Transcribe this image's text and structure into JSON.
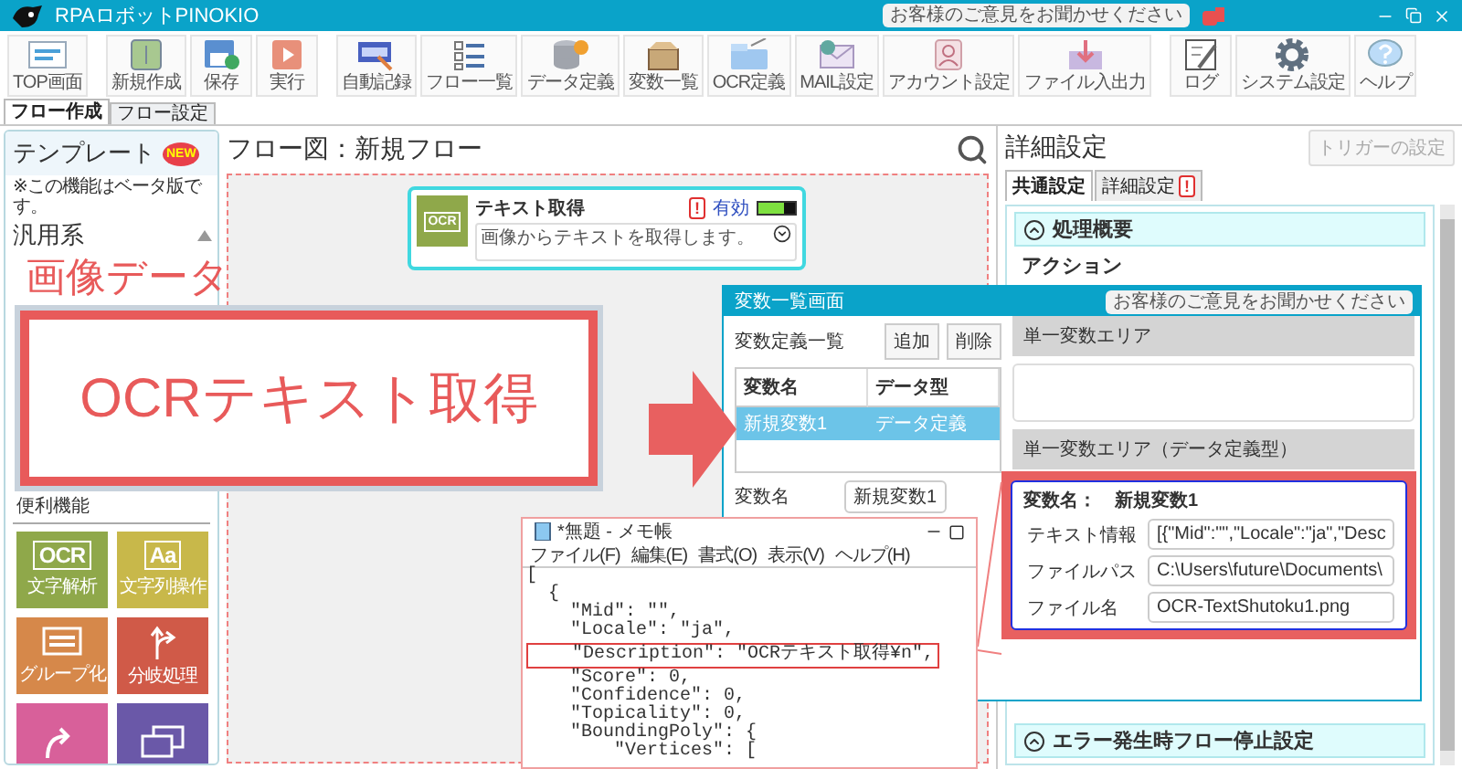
{
  "title_bar": {
    "title": "RPAロボットPINOKIO",
    "feedback": "お客様のご意見をお聞かせください"
  },
  "toolbar_groups": [
    [
      {
        "label": "TOP画面",
        "kind": "top"
      }
    ],
    [
      {
        "label": "新規作成",
        "kind": "new"
      },
      {
        "label": "保存",
        "kind": "save"
      },
      {
        "label": "実行",
        "kind": "run"
      }
    ],
    [
      {
        "label": "自動記録",
        "kind": "record"
      },
      {
        "label": "フロー一覧",
        "kind": "list"
      },
      {
        "label": "データ定義",
        "kind": "data"
      },
      {
        "label": "変数一覧",
        "kind": "vars"
      },
      {
        "label": "OCR定義",
        "kind": "ocr"
      },
      {
        "label": "MAIL設定",
        "kind": "mail"
      },
      {
        "label": "アカウント設定",
        "kind": "account"
      },
      {
        "label": "ファイル入出力",
        "kind": "file"
      }
    ],
    [
      {
        "label": "ログ",
        "kind": "log"
      },
      {
        "label": "システム設定",
        "kind": "settings"
      },
      {
        "label": "ヘルプ",
        "kind": "help"
      }
    ]
  ],
  "main_tabs": [
    {
      "label": "フロー作成",
      "selected": true
    },
    {
      "label": "フロー設定",
      "selected": false
    }
  ],
  "sidebar": {
    "title": "テンプレート",
    "badge": "NEW",
    "note": "※この機能はベータ版です。",
    "category": "汎用系",
    "section": "便利機能",
    "tiles": [
      {
        "kind": "ocr",
        "icon_text": "OCR",
        "label": "文字解析",
        "color": "#8fa84a"
      },
      {
        "kind": "text",
        "icon_text": "Aa",
        "label": "文字列操作",
        "color": "#c8b84a"
      },
      {
        "kind": "group",
        "label": "グループ化",
        "color": "#d6884a"
      },
      {
        "kind": "branch",
        "label": "分岐処理",
        "color": "#d05a48"
      },
      {
        "kind": "loop",
        "color": "#d8609a"
      },
      {
        "kind": "window",
        "color": "#6a58a8"
      }
    ]
  },
  "canvas": {
    "title": "フロー図：新規フロー",
    "node": {
      "title": "テキスト取得",
      "icon_text": "OCR",
      "warning": "!",
      "status": "有効",
      "enabled": true,
      "description": "画像からテキストを取得します。"
    }
  },
  "details": {
    "title": "詳細設定",
    "trigger_button": {
      "label": "トリガーの設定",
      "disabled": true
    },
    "tabs": [
      {
        "label": "共通設定",
        "selected": true
      },
      {
        "label": "詳細設定",
        "selected": false,
        "warning": "!"
      }
    ],
    "top_section": {
      "title": "処理概要",
      "expanded": true
    },
    "action_label": "アクション",
    "bottom_section": {
      "title": "エラー発生時フロー停止設定",
      "expanded": true
    }
  },
  "annotation": {
    "caption": "画像データ",
    "image_text": "OCRテキスト取得"
  },
  "variable_dialog": {
    "title": "変数一覧画面",
    "feedback": "お客様のご意見をお聞かせください",
    "list_title": "変数定義一覧",
    "buttons": [
      "追加",
      "削除"
    ],
    "columns": [
      "変数名",
      "データ型"
    ],
    "rows": [
      {
        "cells": [
          "新規変数1",
          "データ定義"
        ],
        "selected": true
      }
    ],
    "name_label": "変数名",
    "name_value": "新規変数1",
    "area_title": "単一変数エリア",
    "typed_area_title": "単一変数エリア（データ定義型）"
  },
  "variable_detail": {
    "name_label": "変数名：",
    "name_value": "新規変数1",
    "fields": [
      {
        "label": "テキスト情報",
        "value": "[{\"Mid\":\"\",\"Locale\":\"ja\",\"Desc"
      },
      {
        "label": "ファイルパス",
        "value": "C:\\Users\\future\\Documents\\"
      },
      {
        "label": "ファイル名",
        "value": "OCR-TextShutoku1.png"
      }
    ]
  },
  "notepad": {
    "title": "*無題 - メモ帳",
    "menu": [
      "ファイル(F)",
      "編集(E)",
      "書式(O)",
      "表示(V)",
      "ヘルプ(H)"
    ],
    "lines": [
      {
        "text": "[",
        "highlighted": false
      },
      {
        "text": "  {",
        "highlighted": false
      },
      {
        "text": "    \"Mid\": \"\",",
        "highlighted": false
      },
      {
        "text": "    \"Locale\": \"ja\",",
        "highlighted": false
      },
      {
        "text": "    \"Description\": \"OCRテキスト取得¥n\",",
        "highlighted": true
      },
      {
        "text": "    \"Score\": 0,",
        "highlighted": false
      },
      {
        "text": "    \"Confidence\": 0,",
        "highlighted": false
      },
      {
        "text": "    \"Topicality\": 0,",
        "highlighted": false
      },
      {
        "text": "    \"BoundingPoly\": {",
        "highlighted": false
      },
      {
        "text": "        \"Vertices\": [",
        "highlighted": false
      }
    ]
  }
}
